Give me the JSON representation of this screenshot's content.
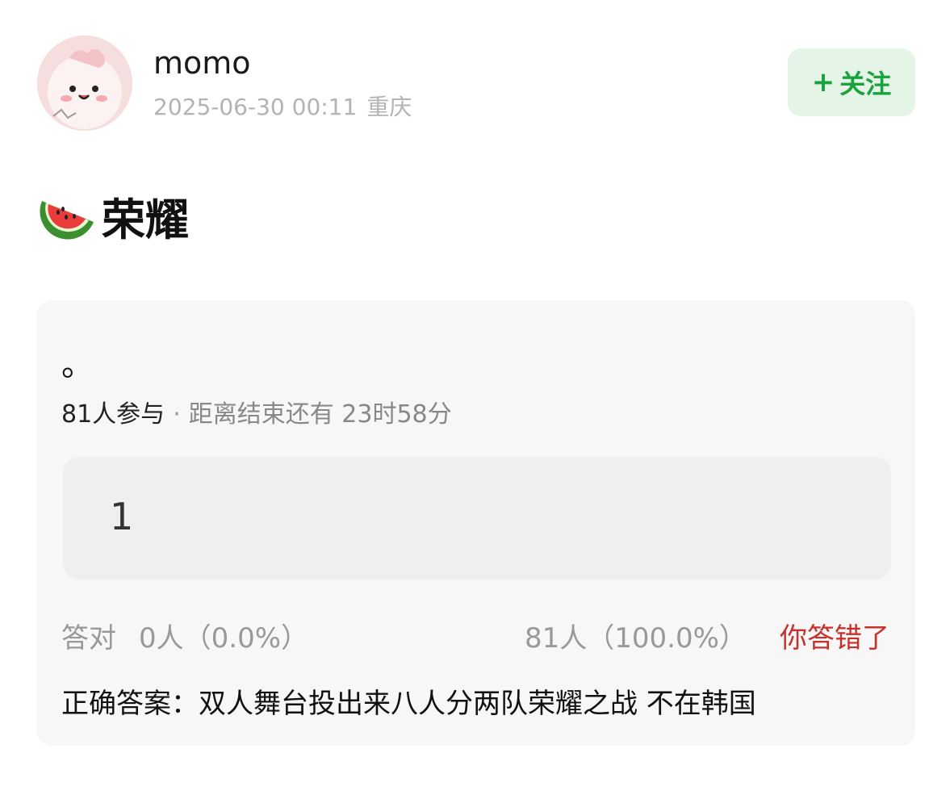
{
  "author": {
    "avatar_icon": "cartoon-face-avatar",
    "name": "momo",
    "date": "2025-06-30 00:11",
    "location": "重庆"
  },
  "follow_button": {
    "icon": "plus-icon",
    "plus": "+",
    "label": "关注",
    "color": "#1aa33d",
    "background": "#e4f5e7"
  },
  "post": {
    "title_icon": "watermelon-icon",
    "title": "荣耀"
  },
  "quiz": {
    "question": "。",
    "participants": "81人参与",
    "separator": "·",
    "time_remaining": "距离结束还有 23时58分",
    "answer_value": "1",
    "correct_label": "答对",
    "correct_count": "0人（0.0%）",
    "wrong_count": "81人（100.0%）",
    "wrong_label": "你答错了",
    "wrong_color": "#c8302c",
    "correct_answer": "正确答案：双人舞台投出来八人分两队荣耀之战 不在韩国"
  }
}
